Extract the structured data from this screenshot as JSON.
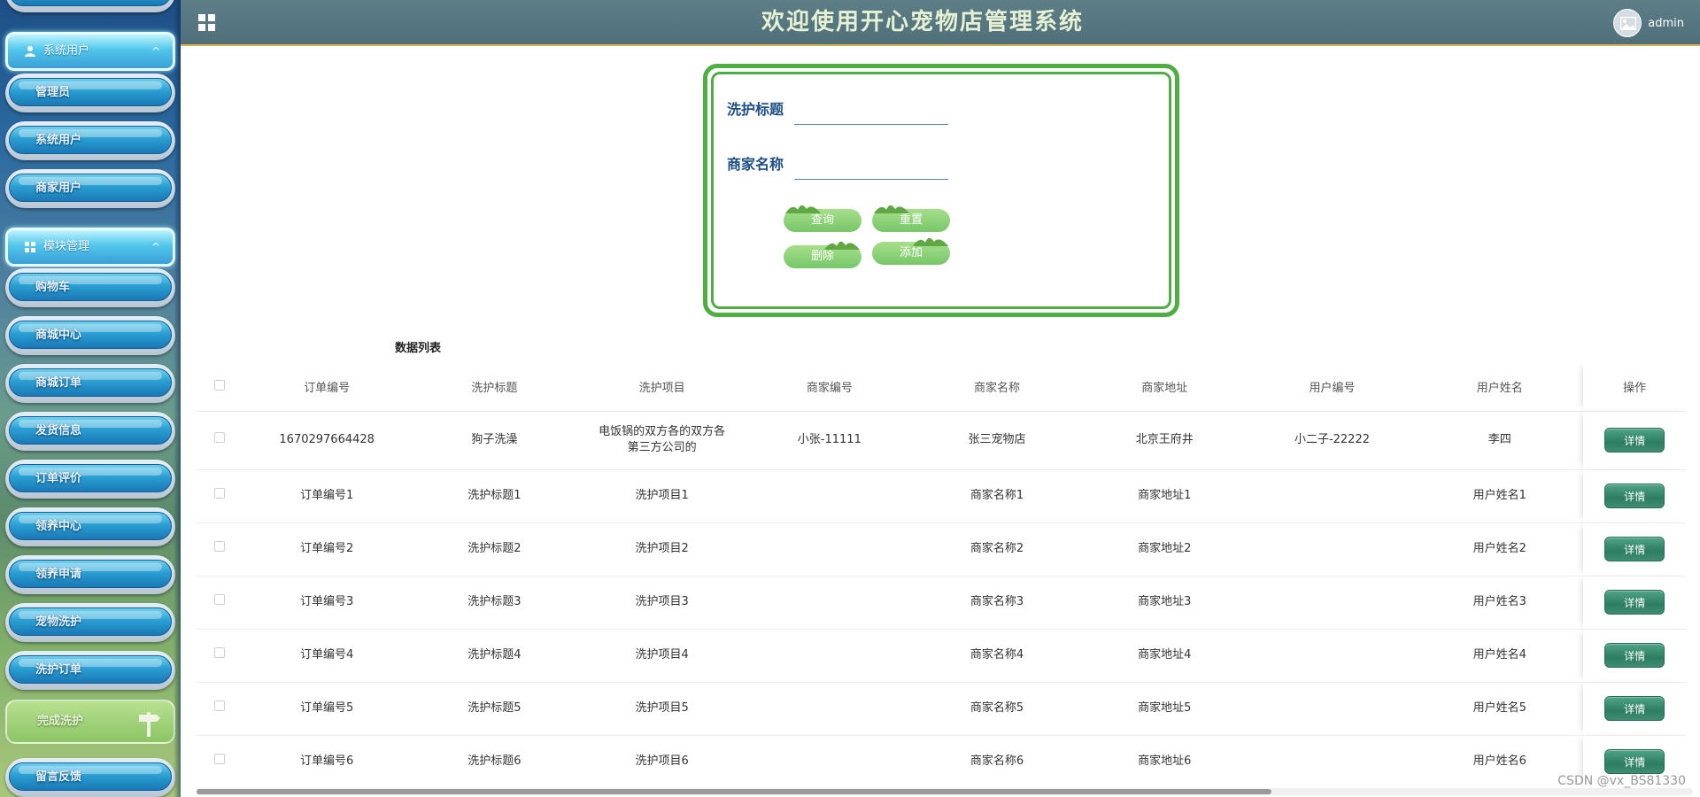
{
  "header": {
    "title": "欢迎使用开心宠物店管理系统",
    "username": "admin"
  },
  "sidebar": {
    "groups": [
      {
        "label": "系统用户",
        "arrow": "^",
        "items": [
          "管理员",
          "系统用户",
          "商家用户"
        ]
      },
      {
        "label": "模块管理",
        "arrow": "^",
        "items": [
          "购物车",
          "商城中心",
          "商城订单",
          "发货信息",
          "订单评价",
          "领养中心",
          "领养申请",
          "宠物洗护",
          "洗护订单",
          "完成洗护",
          "留言反馈"
        ]
      }
    ]
  },
  "search": {
    "title_label": "洗护标题",
    "title_value": "",
    "merchant_label": "商家名称",
    "merchant_value": "",
    "buttons": {
      "query": "查询",
      "reset": "重置",
      "delete": "删除",
      "add": "添加"
    }
  },
  "table": {
    "title": "数据列表",
    "columns": [
      "订单编号",
      "洗护标题",
      "洗护项目",
      "商家编号",
      "商家名称",
      "商家地址",
      "用户编号",
      "用户姓名",
      "操作"
    ],
    "rows": [
      [
        "1670297664428",
        "狗子洗澡",
        "电饭锅的双方各的双方各第三方公司的",
        "小张-11111",
        "张三宠物店",
        "北京王府井",
        "小二子-22222",
        "李四"
      ],
      [
        "订单编号1",
        "洗护标题1",
        "洗护项目1",
        "",
        "商家名称1",
        "商家地址1",
        "",
        "用户姓名1"
      ],
      [
        "订单编号2",
        "洗护标题2",
        "洗护项目2",
        "",
        "商家名称2",
        "商家地址2",
        "",
        "用户姓名2"
      ],
      [
        "订单编号3",
        "洗护标题3",
        "洗护项目3",
        "",
        "商家名称3",
        "商家地址3",
        "",
        "用户姓名3"
      ],
      [
        "订单编号4",
        "洗护标题4",
        "洗护项目4",
        "",
        "商家名称4",
        "商家地址4",
        "",
        "用户姓名4"
      ],
      [
        "订单编号5",
        "洗护标题5",
        "洗护项目5",
        "",
        "商家名称5",
        "商家地址5",
        "",
        "用户姓名5"
      ],
      [
        "订单编号6",
        "洗护标题6",
        "洗护项目6",
        "",
        "商家名称6",
        "商家地址6",
        "",
        "用户姓名6"
      ]
    ],
    "detail_label": "详情"
  },
  "watermark": "CSDN @vx_BS81330",
  "icons": {
    "menu": "grid-icon",
    "avatar": "image-icon",
    "user_group": "user-icon",
    "module_group": "grid-icon",
    "leaf": "leaf-icon",
    "signpost": "signpost-icon"
  },
  "colors": {
    "header_bg": "#567781",
    "header_title": "#e6f0d2",
    "panel_border": "#4eae41",
    "label_blue": "#1d4f86",
    "detail_btn": "#2d7d63",
    "leaf_btn": "#8fd57a"
  }
}
